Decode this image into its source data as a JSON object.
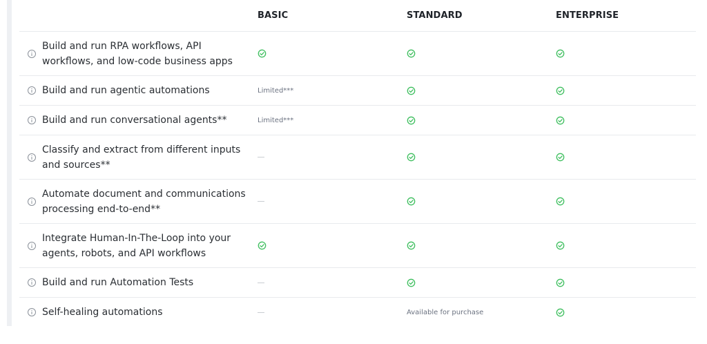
{
  "columns": {
    "basic": "BASIC",
    "standard": "STANDARD",
    "enterprise": "ENTERPRISE"
  },
  "colors": {
    "check": "#3fbf5f",
    "divider": "#e8eaed",
    "icon_gray": "#8a9099"
  },
  "rows": [
    {
      "feature_line1": "Build and run RPA workflows, API",
      "feature_line2": "workflows, and low-code business apps",
      "basic": "check-icon",
      "standard": "check-icon",
      "enterprise": "check-icon"
    },
    {
      "feature_line1": "Build and run agentic automations",
      "basic_text": "Limited***",
      "standard": "check-icon",
      "enterprise": "check-icon"
    },
    {
      "feature_line1": "Build and run conversational agents**",
      "basic_text": "Limited***",
      "standard": "check-icon",
      "enterprise": "check-icon"
    },
    {
      "feature_line1": "Classify and extract from different inputs",
      "feature_line2": "and sources**",
      "basic": "dash-icon",
      "standard": "check-icon",
      "enterprise": "check-icon"
    },
    {
      "feature_line1": "Automate document and communications",
      "feature_line2": "processing end-to-end**",
      "basic": "dash-icon",
      "standard": "check-icon",
      "enterprise": "check-icon"
    },
    {
      "feature_line1": "Integrate Human-In-The-Loop into your",
      "feature_line2": "agents, robots, and API workflows",
      "basic": "check-icon",
      "standard": "check-icon",
      "enterprise": "check-icon"
    },
    {
      "feature_line1": "Build and run Automation Tests",
      "basic": "dash-icon",
      "standard": "check-icon",
      "enterprise": "check-icon"
    },
    {
      "feature_line1": "Self-healing automations",
      "basic": "dash-icon",
      "standard_text": "Available for purchase",
      "enterprise": "check-icon"
    }
  ]
}
